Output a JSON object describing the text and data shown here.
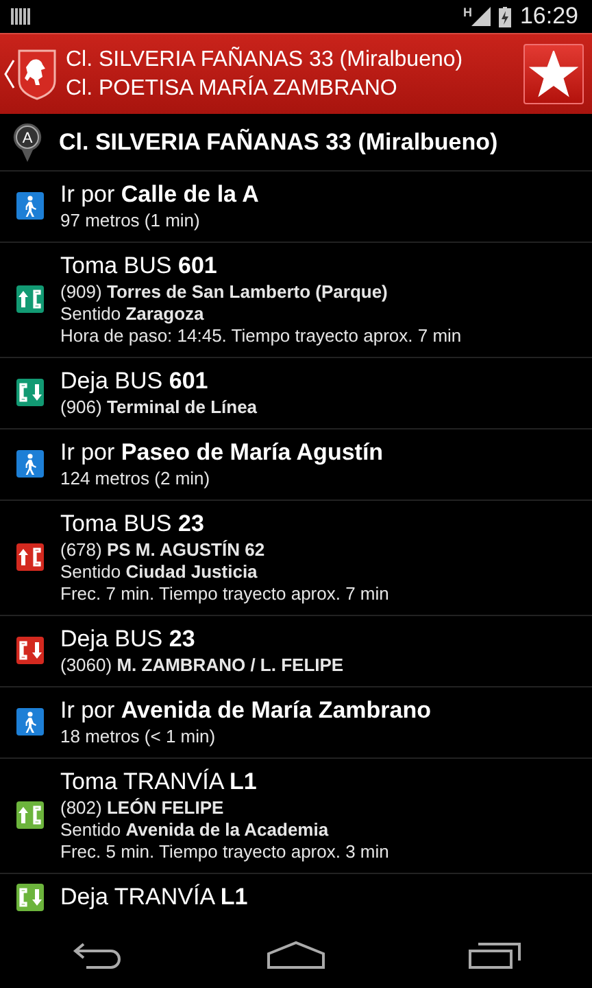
{
  "status_bar": {
    "time": "16:29",
    "network": "H"
  },
  "header": {
    "origin": "Cl. SILVERIA FAÑANAS 33 (Miralbueno)",
    "destination": "Cl. POETISA MARÍA ZAMBRANO",
    "favorite": true
  },
  "start": {
    "marker": "A",
    "label": "Cl. SILVERIA FAÑANAS 33 (Miralbueno)"
  },
  "steps": [
    {
      "kind": "walk",
      "color": "#1d7fd6",
      "title": "Ir por **Calle de la A**",
      "lines": [
        "97 metros (1 min)"
      ]
    },
    {
      "kind": "board",
      "color": "#129a73",
      "title": "Toma BUS **601**",
      "lines": [
        "(909) **Torres de San Lamberto (Parque)**",
        "Sentido **Zaragoza**",
        "Hora de paso: 14:45. Tiempo trayecto aprox. 7 min"
      ]
    },
    {
      "kind": "alight",
      "color": "#129a73",
      "title": "Deja BUS **601**",
      "lines": [
        "(906) **Terminal de Línea**"
      ]
    },
    {
      "kind": "walk",
      "color": "#1d7fd6",
      "title": "Ir por **Paseo de María Agustín**",
      "lines": [
        "124 metros (2 min)"
      ]
    },
    {
      "kind": "board",
      "color": "#d3291f",
      "title": "Toma BUS **23**",
      "lines": [
        "(678) **PS M. AGUSTÍN 62**",
        "Sentido **Ciudad Justicia**",
        "Frec. 7 min. Tiempo trayecto aprox. 7 min"
      ]
    },
    {
      "kind": "alight",
      "color": "#d3291f",
      "title": "Deja BUS **23**",
      "lines": [
        "(3060) **M. ZAMBRANO / L. FELIPE**"
      ]
    },
    {
      "kind": "walk",
      "color": "#1d7fd6",
      "title": "Ir por **Avenida de María Zambrano**",
      "lines": [
        "18 metros (< 1 min)"
      ]
    },
    {
      "kind": "board",
      "color": "#6cb43c",
      "title": "Toma TRANVÍA **L1**",
      "lines": [
        "(802) **LEÓN FELIPE**",
        "Sentido **Avenida de la Academia**",
        "Frec. 5 min. Tiempo trayecto aprox. 3 min"
      ]
    },
    {
      "kind": "alight",
      "color": "#6cb43c",
      "title": "Deja TRANVÍA **L1**"
    }
  ]
}
